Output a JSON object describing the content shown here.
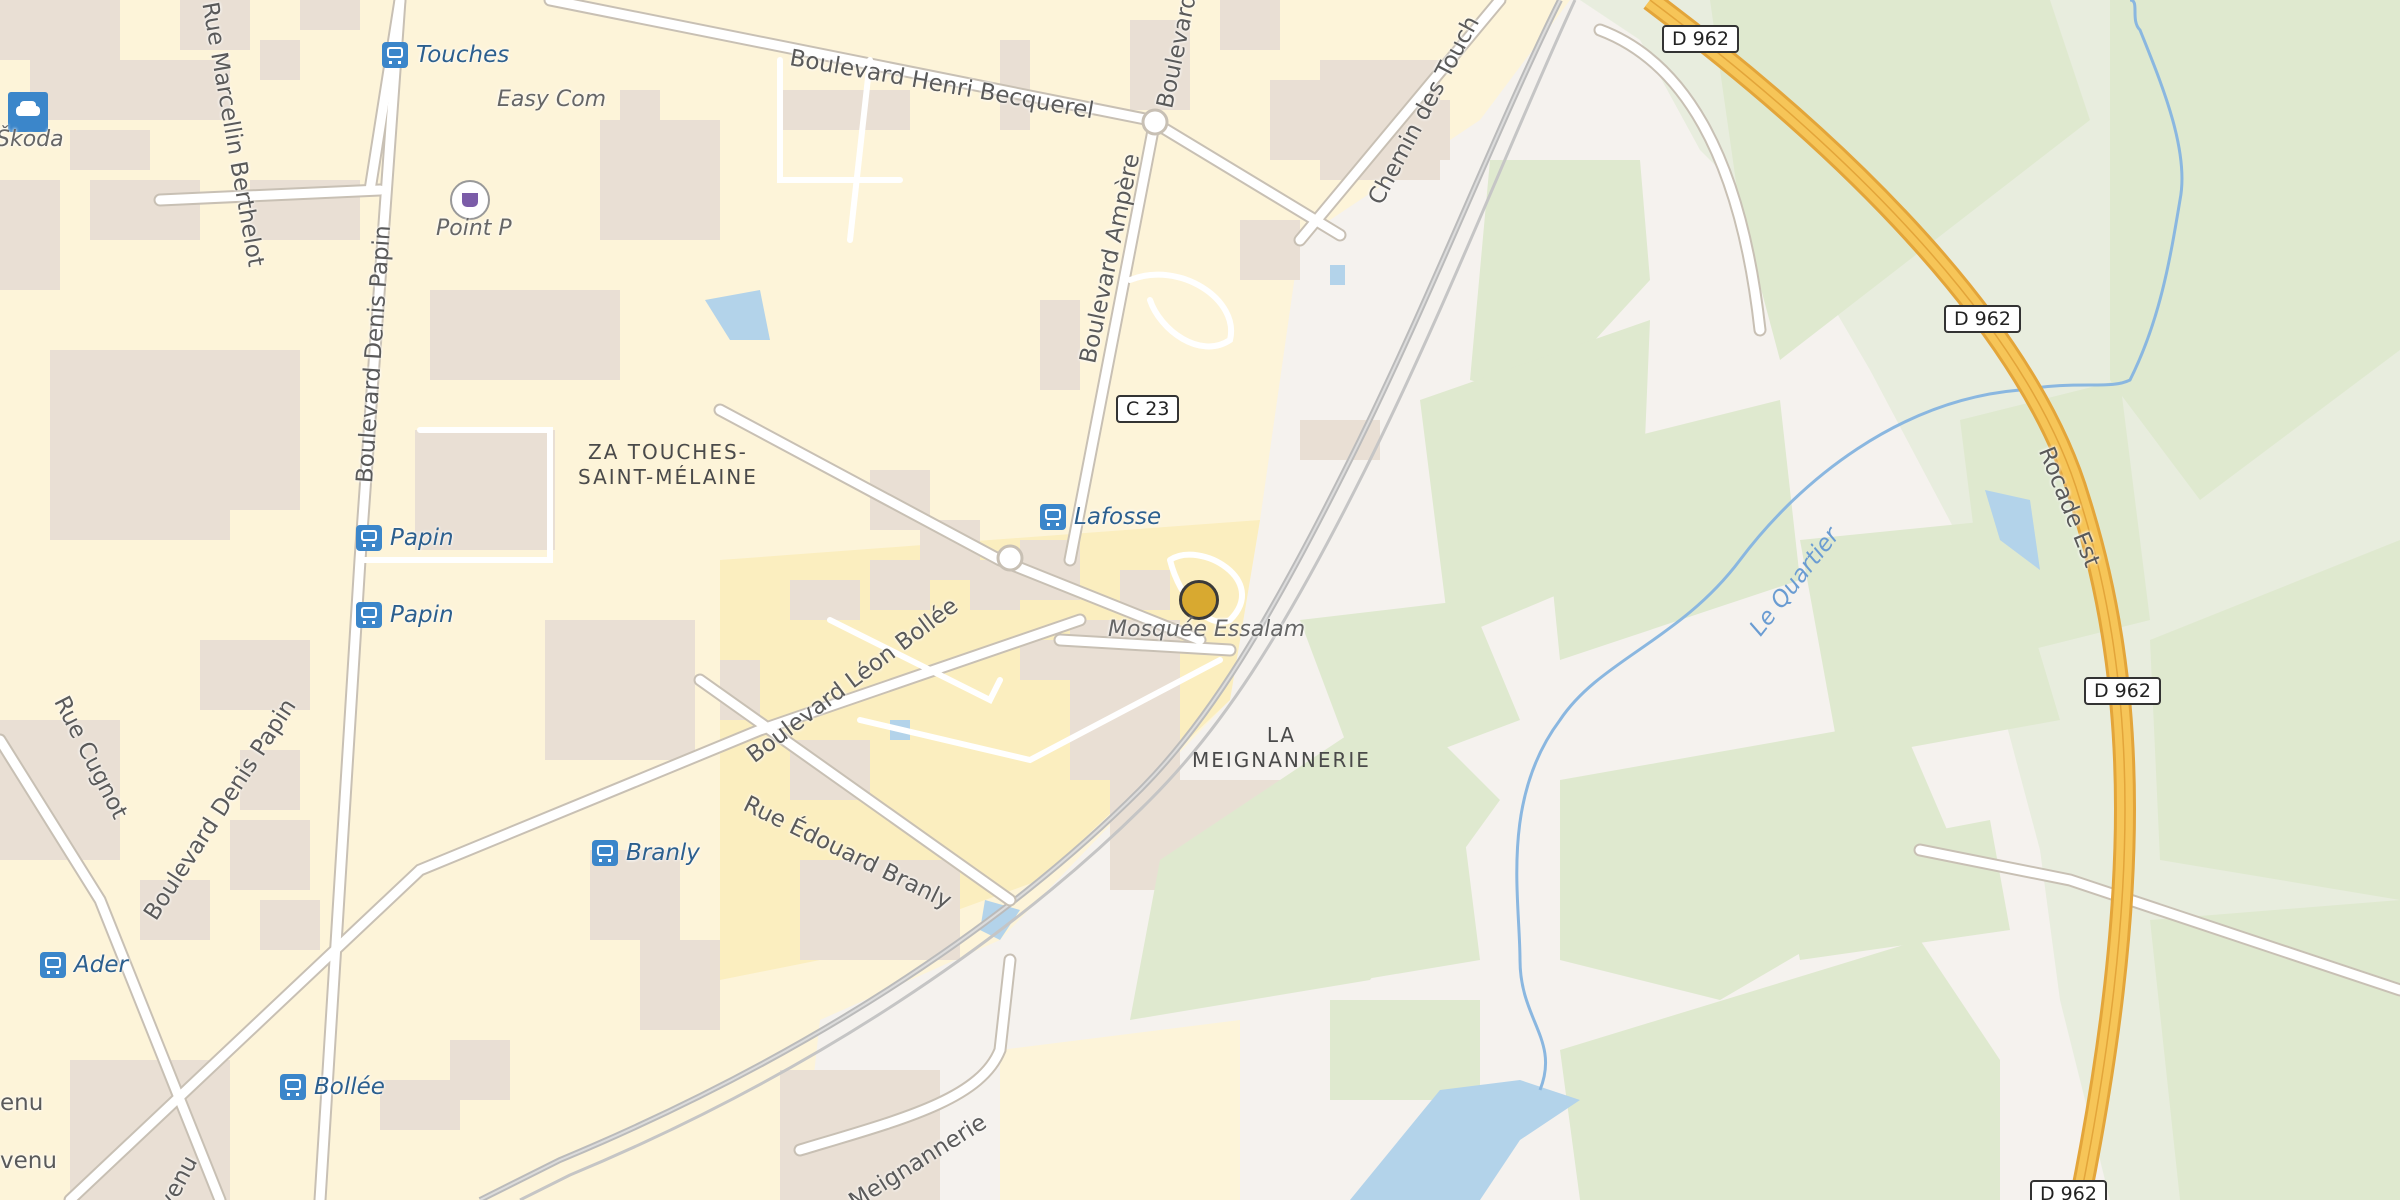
{
  "map": {
    "streets": [
      {
        "id": "henri-becquerel",
        "name": "Boulevard Henri Becquerel"
      },
      {
        "id": "marcellin-berthelot",
        "name": "Rue Marcellin Berthelot"
      },
      {
        "id": "denis-papin-vertical",
        "name": "Boulevard Denis Papin"
      },
      {
        "id": "denis-papin-diagonal",
        "name": "Boulevard Denis Papin"
      },
      {
        "id": "ampere",
        "name": "Boulevard Ampère"
      },
      {
        "id": "ampere-top",
        "name": "Boulevard"
      },
      {
        "id": "chemin-touches",
        "name": "Chemin des Touch"
      },
      {
        "id": "leon-bollee",
        "name": "Boulevard Léon Bollée"
      },
      {
        "id": "edouard-branly",
        "name": "Rue Édouard Branly"
      },
      {
        "id": "cugnot",
        "name": "Rue Cugnot"
      },
      {
        "id": "meignannerie",
        "name": "a Meignannerie"
      },
      {
        "id": "rocade",
        "name": "Rocade Est"
      },
      {
        "id": "venu-1",
        "name": "enu"
      },
      {
        "id": "venu-2",
        "name": "venu"
      },
      {
        "id": "venu-3",
        "name": "venu"
      }
    ],
    "places": [
      {
        "id": "za-touches",
        "line1": "ZA TOUCHES-",
        "line2": "SAINT-MÉLAINE"
      },
      {
        "id": "meignannerie-place",
        "line1": "LA",
        "line2": "MEIGNANNERIE"
      }
    ],
    "bus_stops": [
      {
        "id": "touches",
        "name": "Touches"
      },
      {
        "id": "lafosse",
        "name": "Lafosse"
      },
      {
        "id": "papin-1",
        "name": "Papin"
      },
      {
        "id": "papin-2",
        "name": "Papin"
      },
      {
        "id": "branly",
        "name": "Branly"
      },
      {
        "id": "ader",
        "name": "Ader"
      },
      {
        "id": "bollee",
        "name": "Bollée"
      }
    ],
    "pois": [
      {
        "id": "skoda",
        "name": "Škoda",
        "icon": "car-icon"
      },
      {
        "id": "easy-com",
        "name": "Easy Com"
      },
      {
        "id": "point-p",
        "name": "Point P",
        "icon": "shopping-bag-icon"
      },
      {
        "id": "mosquee",
        "name": "Mosquée Essalam"
      }
    ],
    "road_shields": [
      "D 962",
      "D 962",
      "D 962",
      "D 962",
      "C 23"
    ],
    "water": [
      {
        "id": "quartier",
        "name": "Le Quartier"
      }
    ],
    "colors": {
      "residential": "#fdf4d9",
      "commercial": "#fbeebf",
      "building": "#e9dfd4",
      "forest": "#dfe9cf",
      "meadow": "#e4ecd8",
      "water": "#b3d3ea",
      "motorway": "#f6c558",
      "motorway_casing": "#e3a53a",
      "road": "#ffffff",
      "marker": "#d8a930"
    }
  }
}
